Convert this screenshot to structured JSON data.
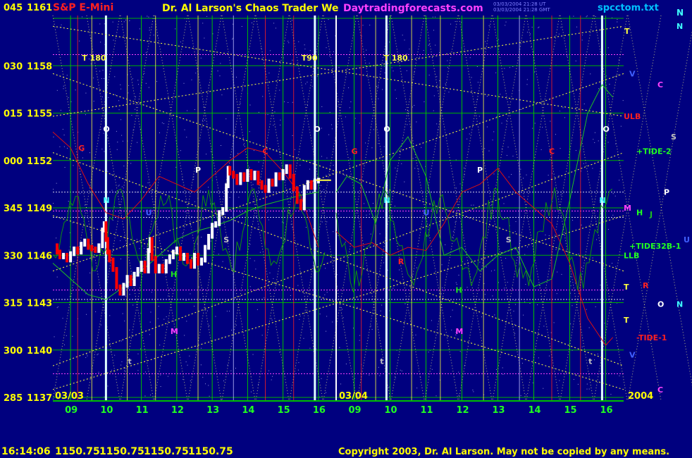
{
  "header": {
    "title_left": "S&P E-Mini",
    "title_main": "Dr. Al Larson's Chaos Trader We",
    "site": "Daytradingforecasts.com",
    "stamp_line1": "03/03/2004 21:28 UT",
    "stamp_line2": "03/03/2004 21:28 GMT",
    "filename": "spcctom.txt",
    "corner_letter": "N"
  },
  "footer": {
    "time": "16:14:06",
    "ohlc": [
      "1150.75",
      "1150.75",
      "1150.75",
      "1150.75"
    ],
    "copyright": "Copyright 2003, Dr. Al Larson. May not be copied by any means."
  },
  "colors": {
    "background": "#00007f",
    "grid_green": "#00c000",
    "dots_yellow": "#ffff40",
    "price_white": "#ffffff",
    "price_red": "#ff2020",
    "bull_up": "#ffffff",
    "bear_down": "#ff0000",
    "line_red": "#dd1010",
    "line_green": "#20c020",
    "magenta": "#ff40ff",
    "cyan": "#40ffff"
  },
  "chart_data": {
    "type": "line",
    "title": "S&P E-Mini",
    "y_axis": {
      "range": [
        1137,
        1161
      ],
      "ticks": [
        {
          "angle": "045",
          "price": 1161
        },
        {
          "angle": "030",
          "price": 1158
        },
        {
          "angle": "015",
          "price": 1155
        },
        {
          "angle": "000",
          "price": 1152
        },
        {
          "angle": "345",
          "price": 1149
        },
        {
          "angle": "330",
          "price": 1146
        },
        {
          "angle": "315",
          "price": 1143
        },
        {
          "angle": "300",
          "price": 1140
        },
        {
          "angle": "285",
          "price": 1137
        }
      ]
    },
    "x_axis": {
      "range": [
        8.5,
        16.5
      ],
      "hour_ticks": [
        "09",
        "10",
        "11",
        "12",
        "13",
        "14",
        "15",
        "16"
      ],
      "date_labels": [
        "03/03",
        "03/04"
      ],
      "year_label": "2004"
    },
    "day_labels": [
      "T 180",
      "T90",
      "T 180"
    ],
    "price_series": [
      {
        "t": 8.55,
        "p": 1146.6
      },
      {
        "t": 8.62,
        "p": 1146.2
      },
      {
        "t": 8.7,
        "p": 1145.9
      },
      {
        "t": 8.8,
        "p": 1146.0
      },
      {
        "t": 8.9,
        "p": 1145.7
      },
      {
        "t": 9.0,
        "p": 1146.1
      },
      {
        "t": 9.1,
        "p": 1146.4
      },
      {
        "t": 9.2,
        "p": 1146.2
      },
      {
        "t": 9.3,
        "p": 1146.7
      },
      {
        "t": 9.4,
        "p": 1146.9
      },
      {
        "t": 9.5,
        "p": 1146.5
      },
      {
        "t": 9.6,
        "p": 1146.4
      },
      {
        "t": 9.7,
        "p": 1146.3
      },
      {
        "t": 9.8,
        "p": 1146.6
      },
      {
        "t": 9.9,
        "p": 1147.6
      },
      {
        "t": 9.95,
        "p": 1148.0
      },
      {
        "t": 10.0,
        "p": 1147.0
      },
      {
        "t": 10.05,
        "p": 1146.2
      },
      {
        "t": 10.1,
        "p": 1145.7
      },
      {
        "t": 10.2,
        "p": 1145.1
      },
      {
        "t": 10.3,
        "p": 1144.0
      },
      {
        "t": 10.4,
        "p": 1143.6
      },
      {
        "t": 10.5,
        "p": 1144.1
      },
      {
        "t": 10.6,
        "p": 1144.6
      },
      {
        "t": 10.7,
        "p": 1144.2
      },
      {
        "t": 10.8,
        "p": 1144.8
      },
      {
        "t": 10.9,
        "p": 1145.1
      },
      {
        "t": 11.0,
        "p": 1145.5
      },
      {
        "t": 11.1,
        "p": 1145.0
      },
      {
        "t": 11.2,
        "p": 1146.3
      },
      {
        "t": 11.25,
        "p": 1147.0
      },
      {
        "t": 11.3,
        "p": 1145.8
      },
      {
        "t": 11.4,
        "p": 1145.0
      },
      {
        "t": 11.5,
        "p": 1145.3
      },
      {
        "t": 11.6,
        "p": 1145.0
      },
      {
        "t": 11.7,
        "p": 1145.6
      },
      {
        "t": 11.8,
        "p": 1145.9
      },
      {
        "t": 11.9,
        "p": 1146.2
      },
      {
        "t": 12.0,
        "p": 1146.4
      },
      {
        "t": 12.1,
        "p": 1145.8
      },
      {
        "t": 12.2,
        "p": 1146.0
      },
      {
        "t": 12.3,
        "p": 1145.6
      },
      {
        "t": 12.4,
        "p": 1145.3
      },
      {
        "t": 12.5,
        "p": 1146.0
      },
      {
        "t": 12.6,
        "p": 1145.5
      },
      {
        "t": 12.7,
        "p": 1145.7
      },
      {
        "t": 12.8,
        "p": 1146.5
      },
      {
        "t": 12.9,
        "p": 1147.2
      },
      {
        "t": 13.0,
        "p": 1147.9
      },
      {
        "t": 13.1,
        "p": 1148.0
      },
      {
        "t": 13.2,
        "p": 1148.7
      },
      {
        "t": 13.3,
        "p": 1148.9
      },
      {
        "t": 13.4,
        "p": 1150.4
      },
      {
        "t": 13.45,
        "p": 1151.5
      },
      {
        "t": 13.5,
        "p": 1151.2
      },
      {
        "t": 13.6,
        "p": 1151.0
      },
      {
        "t": 13.7,
        "p": 1150.6
      },
      {
        "t": 13.8,
        "p": 1151.1
      },
      {
        "t": 13.9,
        "p": 1150.8
      },
      {
        "t": 14.0,
        "p": 1151.3
      },
      {
        "t": 14.1,
        "p": 1150.9
      },
      {
        "t": 14.2,
        "p": 1151.2
      },
      {
        "t": 14.3,
        "p": 1150.6
      },
      {
        "t": 14.4,
        "p": 1150.3
      },
      {
        "t": 14.5,
        "p": 1150.1
      },
      {
        "t": 14.6,
        "p": 1150.7
      },
      {
        "t": 14.7,
        "p": 1150.5
      },
      {
        "t": 14.8,
        "p": 1151.1
      },
      {
        "t": 14.9,
        "p": 1150.9
      },
      {
        "t": 15.0,
        "p": 1151.3
      },
      {
        "t": 15.1,
        "p": 1151.6
      },
      {
        "t": 15.2,
        "p": 1151.0
      },
      {
        "t": 15.3,
        "p": 1150.2
      },
      {
        "t": 15.4,
        "p": 1149.4
      },
      {
        "t": 15.5,
        "p": 1149.0
      },
      {
        "t": 15.6,
        "p": 1150.3
      },
      {
        "t": 15.7,
        "p": 1150.6
      },
      {
        "t": 15.8,
        "p": 1150.3
      },
      {
        "t": 15.9,
        "p": 1150.7
      },
      {
        "t": 16.0,
        "p": 1150.75
      }
    ]
  }
}
